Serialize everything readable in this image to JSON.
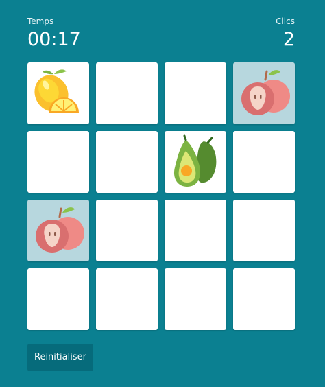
{
  "stats": {
    "time_label": "Temps",
    "time_value": "00:17",
    "clicks_label": "Clics",
    "clicks_value": "2"
  },
  "board": {
    "cards": [
      {
        "state": "revealed",
        "fruit": "lemon-icon"
      },
      {
        "state": "hidden"
      },
      {
        "state": "hidden"
      },
      {
        "state": "matched",
        "fruit": "apple-icon"
      },
      {
        "state": "hidden"
      },
      {
        "state": "hidden"
      },
      {
        "state": "revealed",
        "fruit": "avocado-icon"
      },
      {
        "state": "hidden"
      },
      {
        "state": "matched",
        "fruit": "apple-icon"
      },
      {
        "state": "hidden"
      },
      {
        "state": "hidden"
      },
      {
        "state": "hidden"
      },
      {
        "state": "hidden"
      },
      {
        "state": "hidden"
      },
      {
        "state": "hidden"
      },
      {
        "state": "hidden"
      }
    ]
  },
  "controls": {
    "reset_label": "Reinitialiser"
  },
  "colors": {
    "background": "#0b8091",
    "card_hidden": "#ffffff",
    "card_matched": "#b7d7de",
    "button": "#066b7b"
  }
}
